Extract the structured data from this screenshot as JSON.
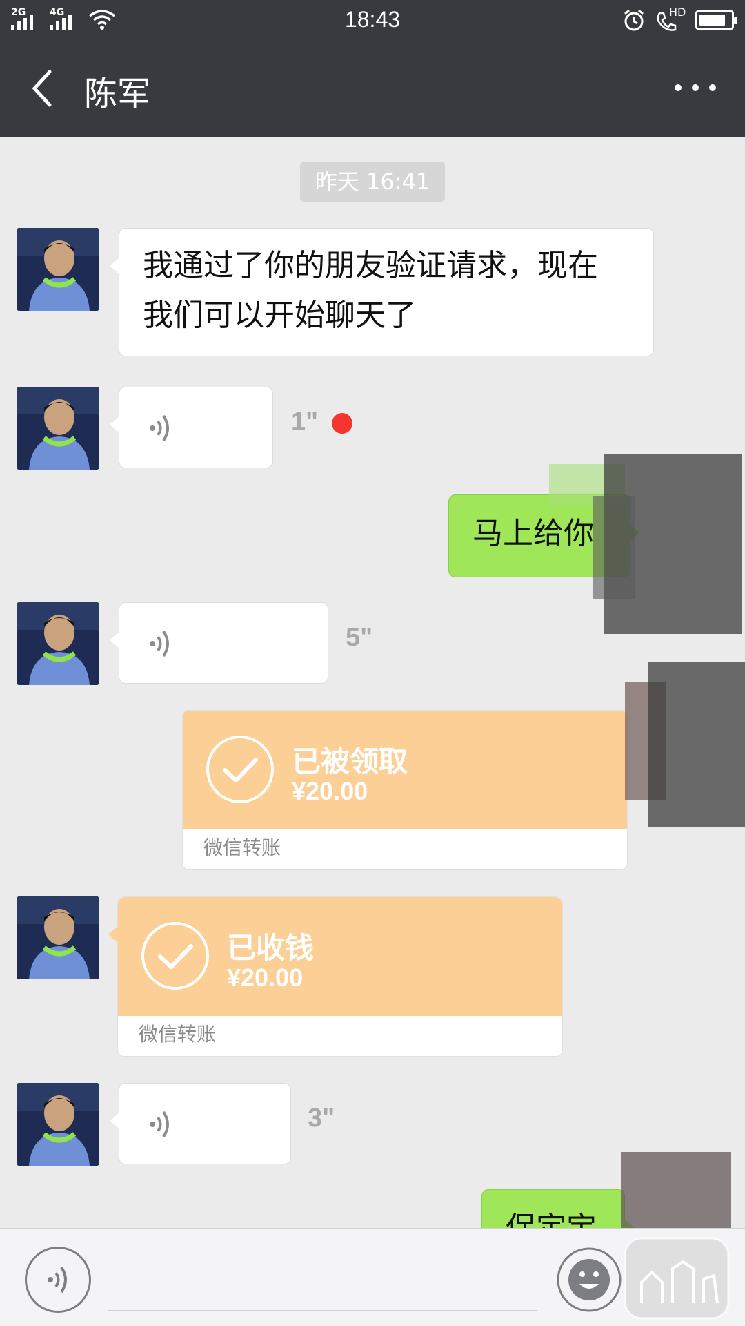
{
  "status_bar": {
    "time": "18:43",
    "sim1_label": "2G",
    "sim2_label": "4G",
    "hd_label": "HD",
    "icons": [
      "signal-icon",
      "wifi-icon",
      "alarm-icon",
      "hd-call-icon",
      "battery-icon"
    ],
    "battery_level": 0.85
  },
  "header": {
    "back_icon": "chevron-left-icon",
    "title": "陈军",
    "more_icon": "more-dots-icon"
  },
  "chat": {
    "timestamp": "昨天 16:41",
    "messages": [
      {
        "type": "text",
        "direction": "in",
        "text_line1": "我通过了你的朋友验证请求，现在",
        "text_line2": "我们可以开始聊天了"
      },
      {
        "type": "voice",
        "direction": "in",
        "duration": "1\"",
        "unread": true
      },
      {
        "type": "text",
        "direction": "out",
        "text": "马上给你"
      },
      {
        "type": "voice",
        "direction": "in",
        "duration": "5\""
      },
      {
        "type": "transfer",
        "direction": "out",
        "status": "已被领取",
        "amount": "¥20.00",
        "caption": "微信转账"
      },
      {
        "type": "transfer",
        "direction": "in",
        "status": "已收钱",
        "amount": "¥20.00",
        "caption": "微信转账"
      },
      {
        "type": "voice",
        "direction": "in",
        "duration": "3\""
      },
      {
        "type": "text",
        "direction": "out",
        "text": "保定宝"
      }
    ]
  },
  "input_bar": {
    "voice_icon": "voice-input-icon",
    "emoji_icon": "emoji-icon"
  },
  "colors": {
    "header_bg": "#393a3f",
    "chat_bg": "#ebebeb",
    "outgoing_bubble": "#9fe658",
    "transfer_bg": "#fbcf96",
    "unread_dot": "#f43530"
  }
}
